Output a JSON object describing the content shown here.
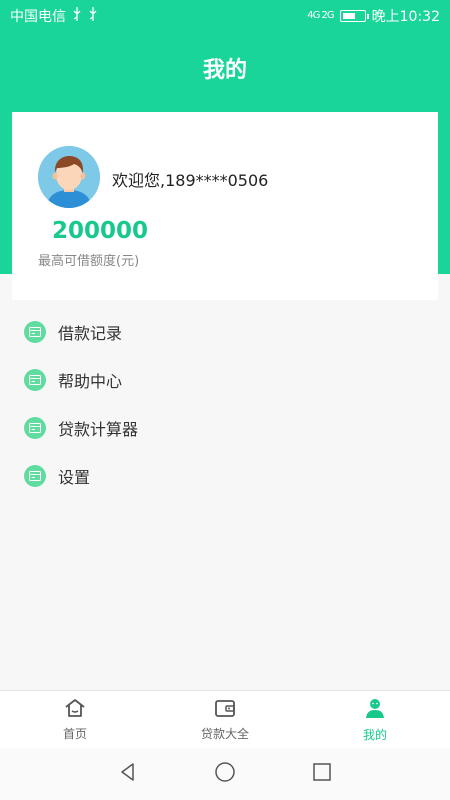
{
  "status_bar": {
    "carrier": "中国电信",
    "signal_text": "4G 2G",
    "time": "晚上10:32"
  },
  "header": {
    "title": "我的"
  },
  "profile": {
    "welcome": "欢迎您,189****0506",
    "limit_amount": "200000",
    "limit_label": "最高可借额度(元)"
  },
  "menu": {
    "items": [
      {
        "label": "借款记录",
        "icon": "card-icon"
      },
      {
        "label": "帮助中心",
        "icon": "card-icon"
      },
      {
        "label": "贷款计算器",
        "icon": "card-icon"
      },
      {
        "label": "设置",
        "icon": "card-icon"
      }
    ]
  },
  "tabs": [
    {
      "label": "首页",
      "icon": "home-icon",
      "active": false
    },
    {
      "label": "贷款大全",
      "icon": "wallet-icon",
      "active": false
    },
    {
      "label": "我的",
      "icon": "person-icon",
      "active": true
    }
  ],
  "colors": {
    "brand_green": "#19d59a",
    "accent_green": "#19c98c"
  }
}
